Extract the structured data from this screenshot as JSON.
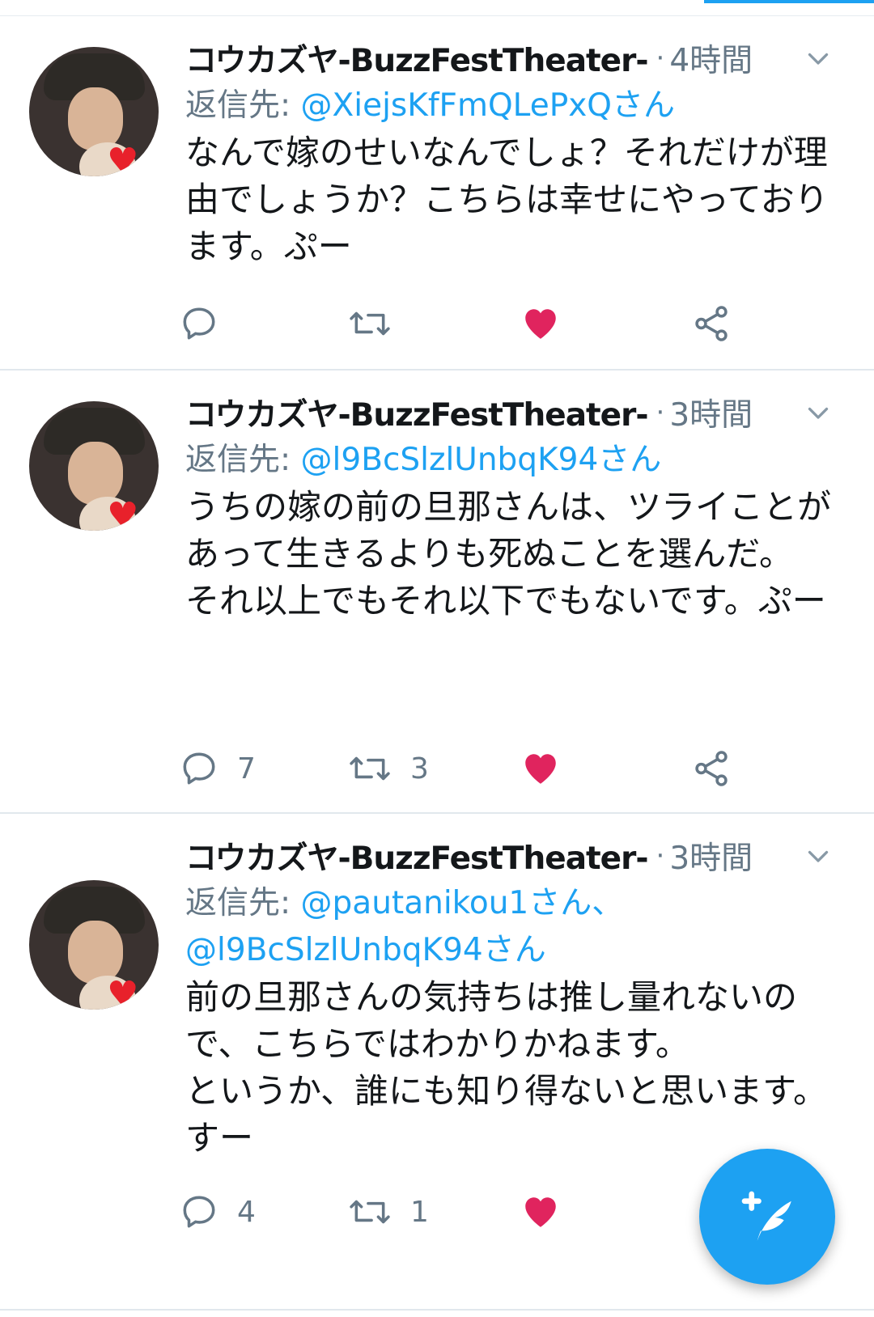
{
  "tweets": [
    {
      "author": "コウカズヤ-BuzzFestTheater-",
      "separator": "·",
      "time": "4時間",
      "reply_prefix": "返信先: ",
      "reply_handles": "@XiejsKfFmQLePxQさん",
      "reply_handles_line2": "",
      "text": "なんで嫁のせいなんでしょ？それだけが理由でしょうか？こちらは幸せにやっております。ぷー",
      "reply_count": "",
      "retweet_count": "",
      "liked": true
    },
    {
      "author": "コウカズヤ-BuzzFestTheater-",
      "separator": "·",
      "time": "3時間",
      "reply_prefix": "返信先: ",
      "reply_handles": "@l9BcSlzlUnbqK94さん",
      "reply_handles_line2": "",
      "text": "うちの嫁の前の旦那さんは、ツライことがあって生きるよりも死ぬことを選んだ。\nそれ以上でもそれ以下でもないです。ぷー",
      "reply_count": "7",
      "retweet_count": "3",
      "liked": true
    },
    {
      "author": "コウカズヤ-BuzzFestTheater-",
      "separator": "·",
      "time": "3時間",
      "reply_prefix": "返信先: ",
      "reply_handles": "@pautanikou1さん、",
      "reply_handles_line2": "@l9BcSlzlUnbqK94さん",
      "text": "前の旦那さんの気持ちは推し量れないので、こちらではわかりかねます。\nというか、誰にも知り得ないと思います。すー",
      "reply_count": "4",
      "retweet_count": "1",
      "liked": true
    }
  ],
  "colors": {
    "accent": "#1da1f2",
    "like": "#e0245e",
    "muted": "#657786",
    "text": "#14171a"
  },
  "icons": {
    "reply": "reply-icon",
    "retweet": "retweet-icon",
    "like": "heart-icon",
    "share": "share-icon",
    "compose": "compose-tweet-icon",
    "menu": "chevron-down-icon"
  }
}
